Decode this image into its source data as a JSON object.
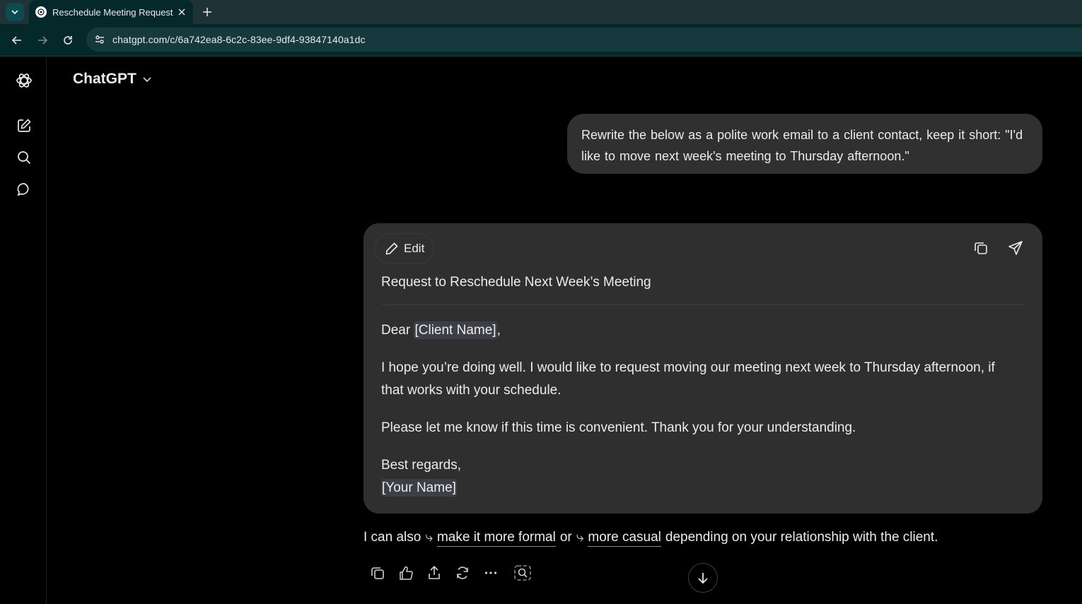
{
  "browser": {
    "tab_title": "Reschedule Meeting Request",
    "url": "chatgpt.com/c/6a742ea8-6c2c-83ee-9df4-93847140a1dc"
  },
  "app": {
    "model_name": "ChatGPT"
  },
  "conversation": {
    "user_message": "Rewrite the below as a polite work email to a client contact, keep it short: \"I'd like to move next week's meeting to Thursday afternoon.\"",
    "canvas": {
      "edit_label": "Edit",
      "subject": "Request to Reschedule Next Week’s Meeting",
      "greeting_prefix": "Dear ",
      "client_placeholder": "[Client Name]",
      "greeting_suffix": ",",
      "paragraph1": "I hope you’re doing well. I would like to request moving our meeting next week to Thursday afternoon, if that works with your schedule.",
      "paragraph2": "Please let me know if this time is convenient. Thank you for your understanding.",
      "signoff": "Best regards,",
      "name_placeholder": "[Your Name]"
    },
    "followup": {
      "prefix": "I can also",
      "arrow": "⤷",
      "option1": "make it more formal",
      "connector": "or",
      "option2": "more casual",
      "suffix": "depending on your relationship with the client."
    }
  },
  "colors": {
    "background": "#000000",
    "bubble": "#303030",
    "canvas": "#2f2f2f",
    "tabbar": "#1f3336",
    "addressbar": "#05282b"
  },
  "icons": [
    "tab-list-icon",
    "openai-logo",
    "close-icon",
    "plus-icon",
    "back-arrow-icon",
    "forward-arrow-icon",
    "reload-icon",
    "site-settings-icon",
    "new-chat-icon",
    "search-icon",
    "chat-bubble-icon",
    "chevron-down-icon",
    "pencil-icon",
    "copy-icon",
    "send-icon",
    "thumbs-icon",
    "share-icon",
    "regenerate-icon",
    "more-icon",
    "screenshot-icon",
    "arrow-down-icon"
  ]
}
